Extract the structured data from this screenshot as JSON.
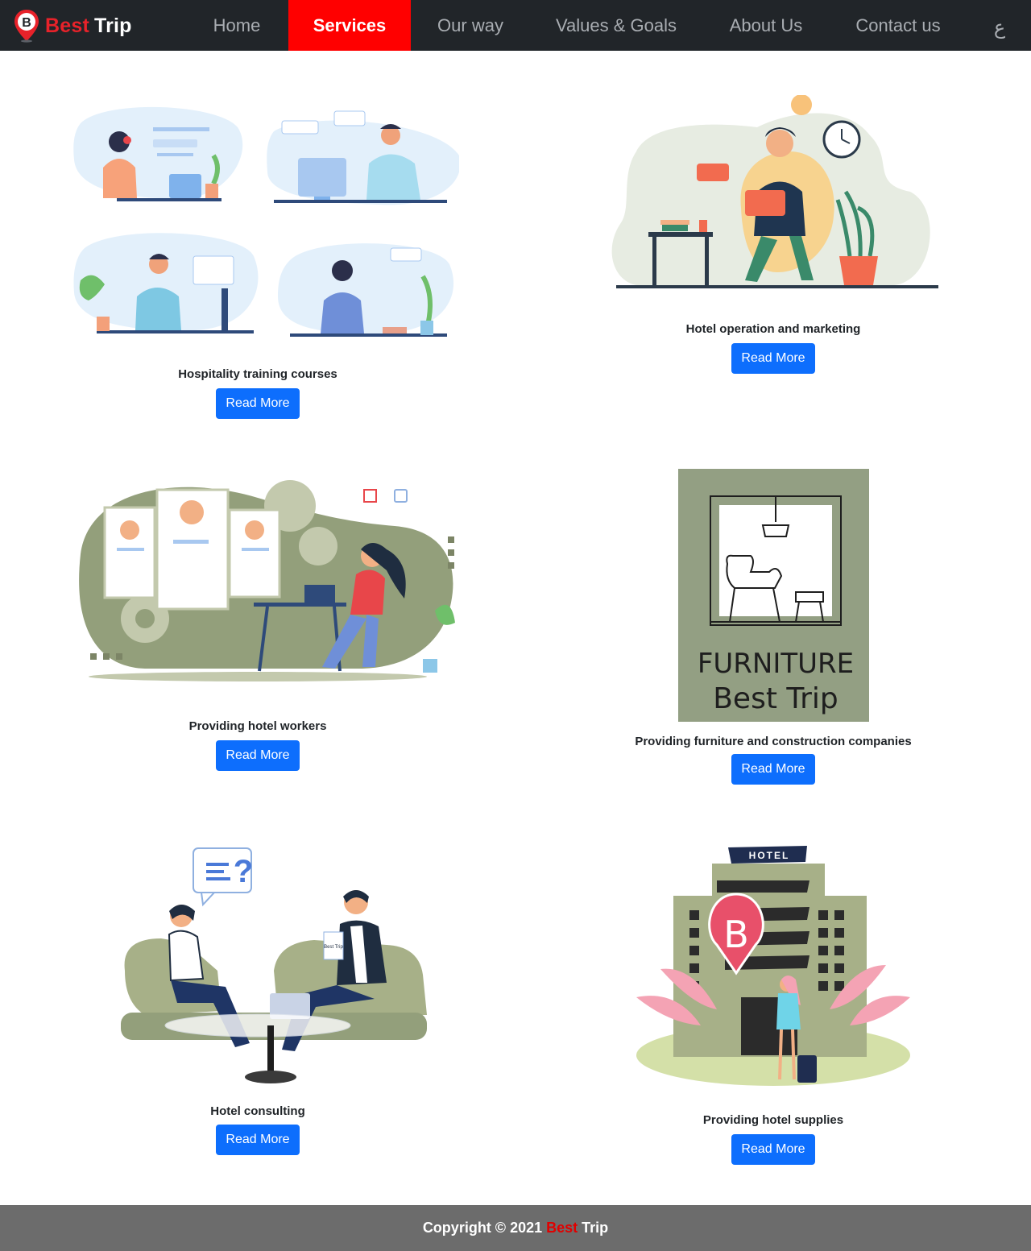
{
  "brand": {
    "best": "Best",
    "trip": "Trip",
    "logo_letter": "B"
  },
  "nav": {
    "items": [
      {
        "label": "Home"
      },
      {
        "label": "Services"
      },
      {
        "label": "Our way"
      },
      {
        "label": "Values & Goals"
      },
      {
        "label": "About Us"
      },
      {
        "label": "Contact us"
      }
    ],
    "active": "Services",
    "lang_toggle": "ع"
  },
  "services": [
    {
      "title": "Hospitality training courses",
      "button": "Read More"
    },
    {
      "title": "Hotel operation and marketing",
      "button": "Read More"
    },
    {
      "title": "Providing hotel workers",
      "button": "Read More"
    },
    {
      "title": "Providing furniture and construction companies",
      "button": "Read More",
      "image_text": [
        "FURNITURE",
        "Best Trip"
      ]
    },
    {
      "title": "Hotel consulting",
      "button": "Read More",
      "image_text": [
        "Best Trip"
      ]
    },
    {
      "title": "Providing hotel supplies",
      "button": "Read More",
      "image_text": [
        "HOTEL",
        "B"
      ]
    }
  ],
  "footer": {
    "prefix": "Copyright © 2021",
    "best": "Best",
    "trip": "Trip"
  },
  "colors": {
    "nav_bg": "#212529",
    "active": "#ff0000",
    "brand_red": "#e8222a",
    "button": "#0d6efd",
    "footer_bg": "#6c6c6c"
  },
  "icons": [
    "map-pin-logo-icon"
  ]
}
